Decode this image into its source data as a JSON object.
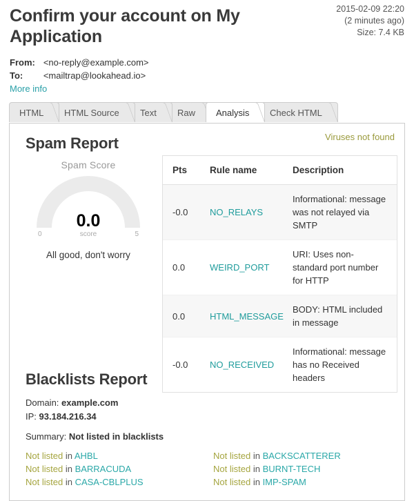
{
  "message": {
    "subject": "Confirm your account on My Application",
    "timestamp": "2015-02-09 22:20",
    "relative_time": "(2 minutes ago)",
    "size": "Size: 7.4 KB",
    "from_label": "From:",
    "from_value": "<no-reply@example.com>",
    "to_label": "To:",
    "to_value": "<mailtrap@lookahead.io>",
    "more_info_label": "More info"
  },
  "tabs": [
    {
      "label": "HTML",
      "active": false
    },
    {
      "label": "HTML Source",
      "active": false
    },
    {
      "label": "Text",
      "active": false
    },
    {
      "label": "Raw",
      "active": false
    },
    {
      "label": "Analysis",
      "active": true
    },
    {
      "label": "Check HTML",
      "active": false
    }
  ],
  "spam_report": {
    "title": "Spam Report",
    "virus_status": "Viruses not found",
    "gauge": {
      "title": "Spam Score",
      "value": "0.0",
      "min_label": "0",
      "max_label": "5",
      "unit_label": "score",
      "verdict": "All good, don't worry",
      "min": 0,
      "max": 5,
      "score": 0.0,
      "track_color": "#ebebeb",
      "fill_color": "#ebebeb"
    },
    "table": {
      "columns": [
        "Pts",
        "Rule name",
        "Description"
      ],
      "rows": [
        {
          "pts": "-0.0",
          "rule": "NO_RELAYS",
          "description": "Informational: message was not relayed via SMTP"
        },
        {
          "pts": "0.0",
          "rule": "WEIRD_PORT",
          "description": "URI: Uses non-standard port number for HTTP"
        },
        {
          "pts": "0.0",
          "rule": "HTML_MESSAGE",
          "description": "BODY: HTML included in message"
        },
        {
          "pts": "-0.0",
          "rule": "NO_RECEIVED",
          "description": "Informational: message has no Received headers"
        }
      ]
    }
  },
  "blacklists_report": {
    "title": "Blacklists Report",
    "domain_label": "Domain:",
    "domain_value": "example.com",
    "ip_label": "IP:",
    "ip_value": "93.184.216.34",
    "summary_label": "Summary:",
    "summary_value": "Not listed in blacklists",
    "entries": [
      {
        "status": "Not listed",
        "in": "in",
        "name": "AHBL"
      },
      {
        "status": "Not listed",
        "in": "in",
        "name": "BACKSCATTERER"
      },
      {
        "status": "Not listed",
        "in": "in",
        "name": "BARRACUDA"
      },
      {
        "status": "Not listed",
        "in": "in",
        "name": "BURNT-TECH"
      },
      {
        "status": "Not listed",
        "in": "in",
        "name": "CASA-CBLPLUS"
      },
      {
        "status": "Not listed",
        "in": "in",
        "name": "IMP-SPAM"
      }
    ]
  },
  "colors": {
    "link": "#2aa0a8",
    "rule_link": "#1f9c9c",
    "olive": "#a5a53f",
    "heading": "#3a3a3a"
  }
}
